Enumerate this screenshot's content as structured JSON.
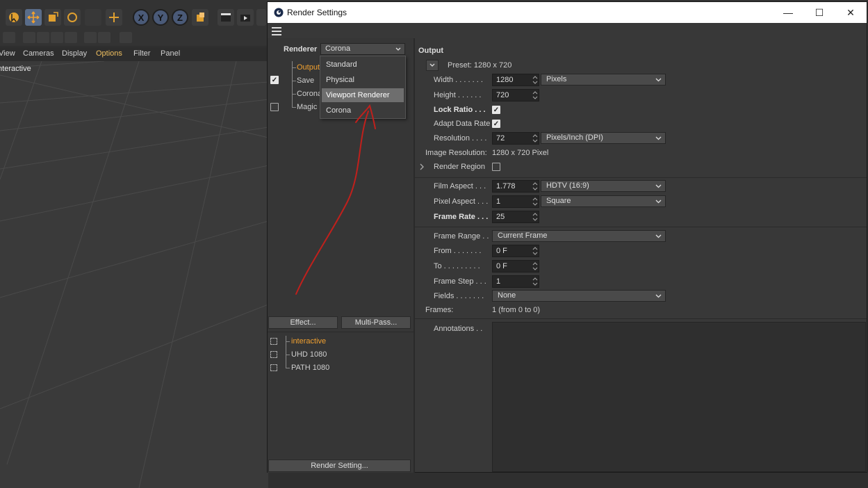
{
  "background_app": {
    "menu": [
      "View",
      "Cameras",
      "Display",
      "Options",
      "Filter",
      "Panel"
    ],
    "viewport_label": "Interactive",
    "axis_buttons": [
      "X",
      "Y",
      "Z"
    ]
  },
  "dialog": {
    "title": "Render Settings",
    "controls": {
      "minimize": "—",
      "maximize": "☐",
      "close": "✕"
    },
    "renderer": {
      "label": "Renderer",
      "selected": "Corona",
      "options": [
        "Standard",
        "Physical",
        "Viewport Renderer",
        "Corona"
      ],
      "highlighted": "Viewport Renderer"
    },
    "tree": [
      {
        "label": "Output",
        "checked": true,
        "active": true
      },
      {
        "label": "Save",
        "checked": null,
        "active": false
      },
      {
        "label": "Corona",
        "checked": null,
        "active": false
      },
      {
        "label": "Magic",
        "checked": false,
        "active": false
      }
    ],
    "buttons": {
      "effect": "Effect...",
      "multipass": "Multi-Pass...",
      "render_setting": "Render Setting..."
    },
    "render_settings_list": [
      {
        "label": "interactive",
        "active": true
      },
      {
        "label": "UHD 1080",
        "active": false
      },
      {
        "label": "PATH 1080",
        "active": false
      }
    ],
    "output": {
      "section_title": "Output",
      "preset": "Preset: 1280 x 720",
      "width": {
        "label": "Width . . . . . . .",
        "value": "1280",
        "unit": "Pixels"
      },
      "height": {
        "label": "Height . . . . . .",
        "value": "720"
      },
      "lock_ratio": {
        "label": "Lock Ratio . . .",
        "checked": true
      },
      "adapt_data_rate": {
        "label": "Adapt Data Rate",
        "checked": true
      },
      "resolution": {
        "label": "Resolution . . . .",
        "value": "72",
        "unit": "Pixels/Inch (DPI)"
      },
      "image_resolution": {
        "label": "Image Resolution:",
        "value": "1280 x 720 Pixel"
      },
      "render_region": {
        "label": "Render Region",
        "checked": false
      },
      "film_aspect": {
        "label": "Film Aspect . . .",
        "value": "1.778",
        "preset": "HDTV (16:9)"
      },
      "pixel_aspect": {
        "label": "Pixel Aspect . . .",
        "value": "1",
        "preset": "Square"
      },
      "frame_rate": {
        "label": "Frame Rate . . .",
        "value": "25"
      },
      "frame_range": {
        "label": "Frame Range . .",
        "value": "Current Frame"
      },
      "from": {
        "label": "From . . . . . . .",
        "value": "0 F"
      },
      "to": {
        "label": "To . . . . . . . . .",
        "value": "0 F"
      },
      "frame_step": {
        "label": "Frame Step . . .",
        "value": "1"
      },
      "fields": {
        "label": "Fields . . . . . . .",
        "value": "None"
      },
      "frames": {
        "label": "Frames:",
        "value": "1 (from 0 to 0)"
      },
      "annotations": {
        "label": "Annotations . .",
        "value": ""
      }
    }
  },
  "colors": {
    "accent_orange": "#f0a030",
    "highlight": "#6e6e6e",
    "annotation_red": "#c0201c"
  }
}
